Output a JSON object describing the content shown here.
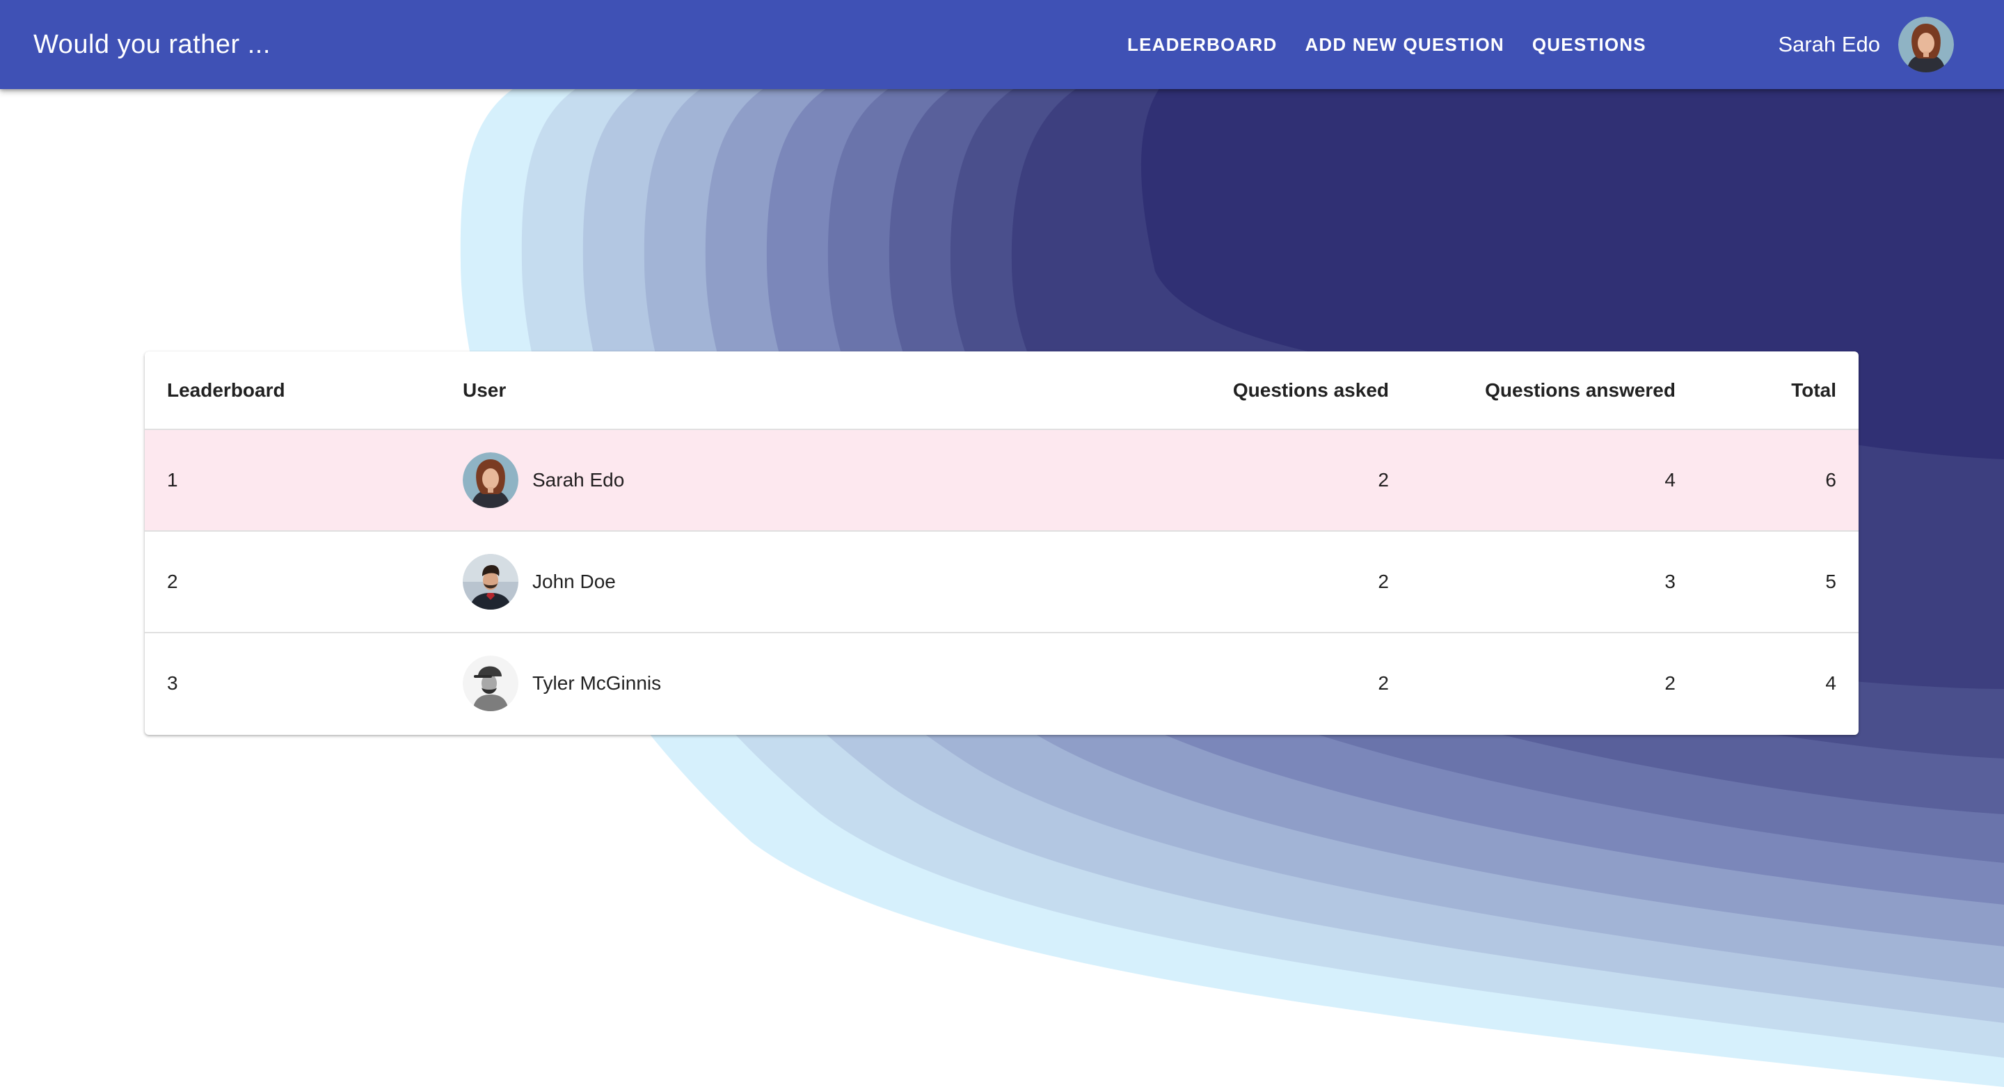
{
  "app": {
    "title": "Would you rather ..."
  },
  "nav": {
    "items": [
      {
        "label": "LEADERBOARD"
      },
      {
        "label": "ADD NEW QUESTION"
      },
      {
        "label": "QUESTIONS"
      }
    ]
  },
  "current_user": {
    "name": "Sarah Edo",
    "avatar_icon": "woman-portrait-avatar"
  },
  "leaderboard": {
    "columns": [
      "Leaderboard",
      "User",
      "Questions asked",
      "Questions answered",
      "Total"
    ],
    "rows": [
      {
        "rank": "1",
        "user": "Sarah Edo",
        "avatar_icon": "woman-portrait-avatar",
        "asked": "2",
        "answered": "4",
        "total": "6",
        "highlighted": true
      },
      {
        "rank": "2",
        "user": "John Doe",
        "avatar_icon": "man-portrait-avatar",
        "asked": "2",
        "answered": "3",
        "total": "5",
        "highlighted": false
      },
      {
        "rank": "3",
        "user": "Tyler McGinnis",
        "avatar_icon": "man-with-cap-avatar",
        "asked": "2",
        "answered": "2",
        "total": "4",
        "highlighted": false
      }
    ]
  },
  "colors": {
    "appbar": "#3f51b5",
    "highlight_row": "#fde8ef",
    "wave_darkest": "#303074",
    "wave_lightest": "#d6f0fc"
  }
}
